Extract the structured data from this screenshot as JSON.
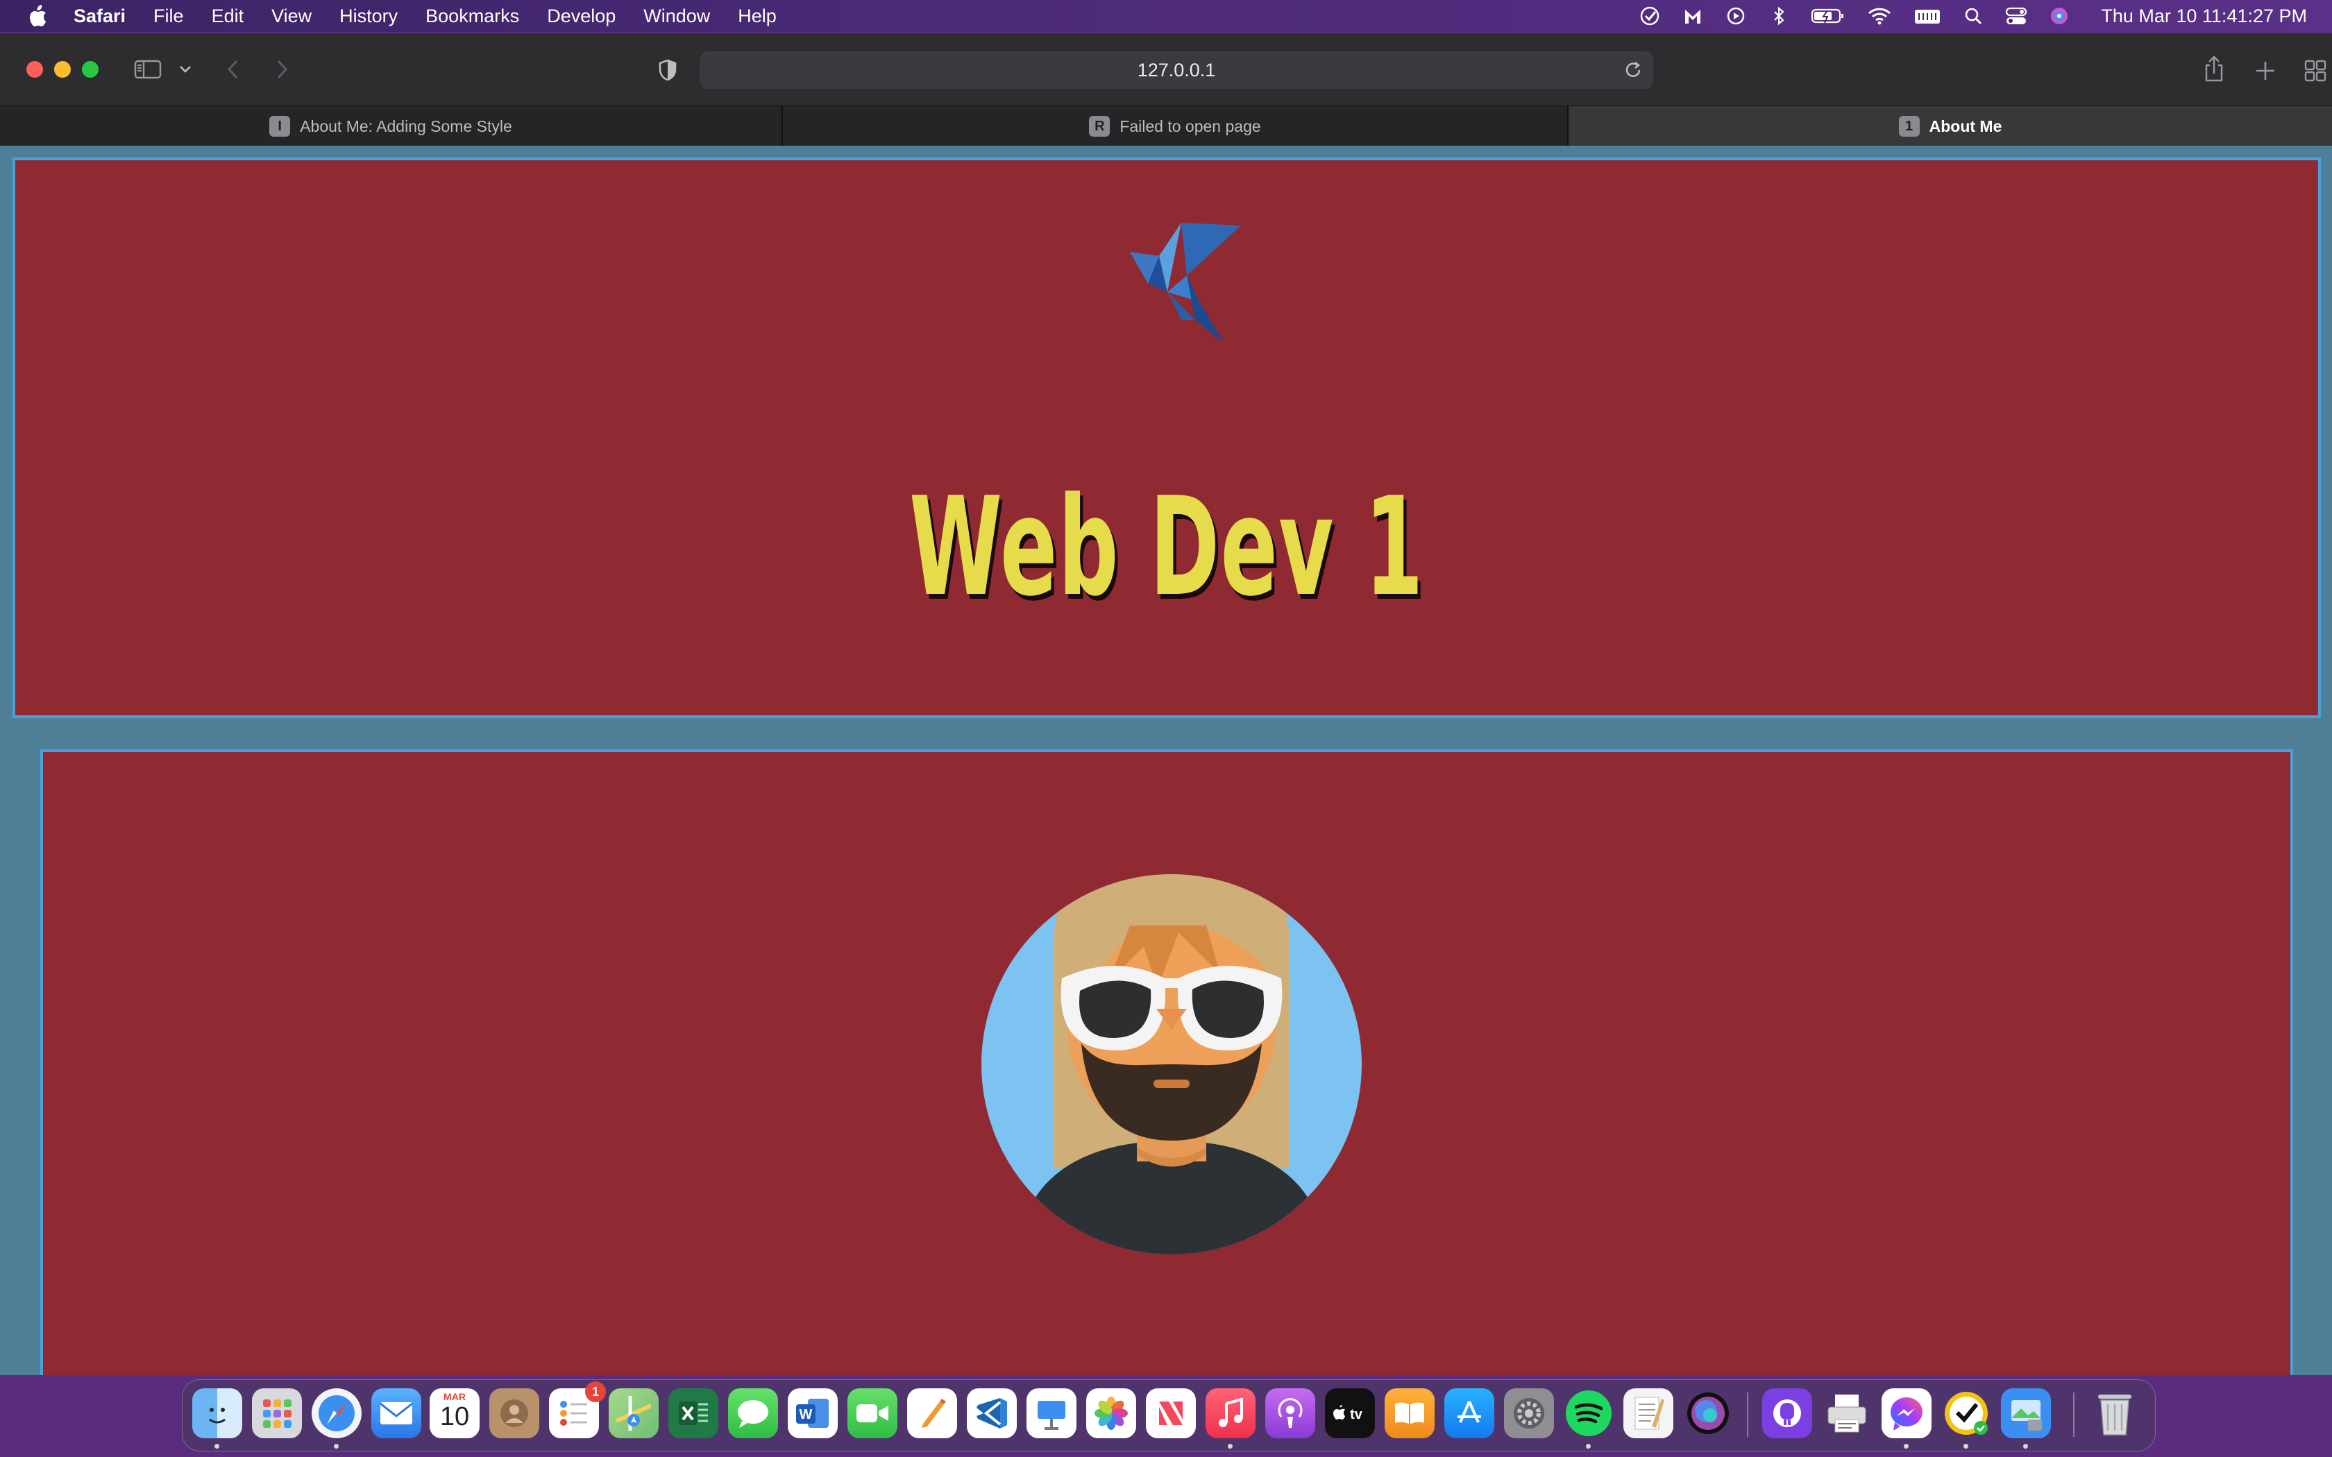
{
  "menubar": {
    "app_name": "Safari",
    "items": [
      "File",
      "Edit",
      "View",
      "History",
      "Bookmarks",
      "Develop",
      "Window",
      "Help"
    ],
    "clock": "Thu Mar 10  11:41:27 PM"
  },
  "browser": {
    "url": "127.0.0.1",
    "tabs": [
      {
        "label": "About Me: Adding Some Style",
        "favicon": "I",
        "active": false
      },
      {
        "label": "Failed to open page",
        "favicon": "R",
        "active": false
      },
      {
        "label": "About Me",
        "favicon": "1",
        "active": true
      }
    ]
  },
  "page": {
    "title": "Web Dev 1",
    "colors": {
      "background": "#4f7f96",
      "box": "#8f2a33",
      "border": "#4ca0d8",
      "title": "#e6db4a"
    }
  },
  "dock": {
    "calendar_month": "MAR",
    "calendar_day": "10",
    "reminders_badge": "1",
    "apps": [
      "finder",
      "launchpad",
      "safari",
      "mail",
      "calendar",
      "contacts",
      "reminders",
      "maps",
      "excel",
      "messages",
      "word",
      "facetime",
      "pages",
      "vscode",
      "keynote",
      "photos",
      "news",
      "music",
      "podcasts",
      "apple-tv",
      "books",
      "app-store",
      "system-preferences",
      "spotify",
      "textedit",
      "siri",
      "github-desktop",
      "printer",
      "messenger",
      "norton",
      "preview",
      "trash"
    ]
  }
}
